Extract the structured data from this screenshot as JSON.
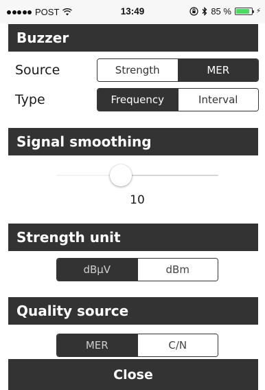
{
  "status_bar": {
    "carrier": "POST",
    "time": "13:49",
    "battery_percent": "85 %",
    "battery_level": 0.85,
    "battery_color": "#4cd964"
  },
  "buzzer": {
    "title": "Buzzer",
    "source": {
      "label": "Source",
      "options": [
        "Strength",
        "MER"
      ],
      "selected": "MER"
    },
    "type": {
      "label": "Type",
      "options": [
        "Frequency",
        "Interval"
      ],
      "selected": "Frequency"
    }
  },
  "signal_smoothing": {
    "title": "Signal smoothing",
    "value": "10",
    "level": 0.4
  },
  "strength_unit": {
    "title": "Strength unit",
    "options": [
      "dBµV",
      "dBm"
    ],
    "selected": "dBµV"
  },
  "quality_source": {
    "title": "Quality source",
    "options": [
      "MER",
      "C/N"
    ],
    "selected": "MER"
  },
  "footer": {
    "close_label": "Close"
  },
  "colors": {
    "header_bg": "#333333",
    "header_text": "#ffffff",
    "background": "#ffffff"
  }
}
